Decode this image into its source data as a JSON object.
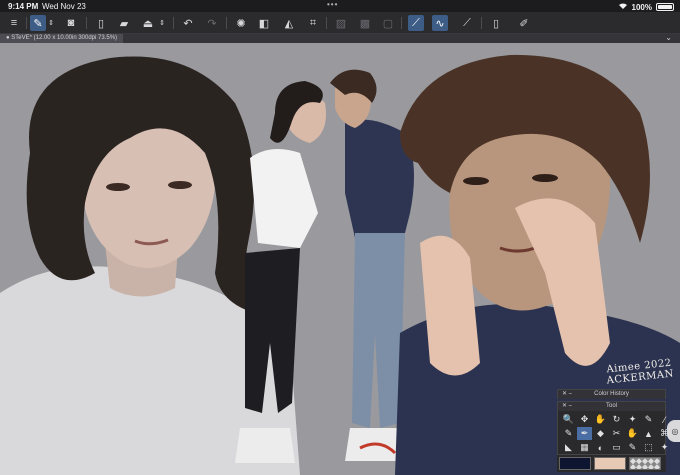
{
  "status": {
    "time": "9:14 PM",
    "date": "Wed Nov 23",
    "dots": "•••",
    "battery": "100%",
    "battery_level": 1.0
  },
  "toolbar": {
    "icons": [
      "menu-icon",
      "pen-icon",
      "chevron-icon",
      "camera-icon",
      "new-file-icon",
      "folder-icon",
      "save-icon",
      "chevron-icon",
      "undo-icon",
      "redo-icon",
      "loading-icon",
      "fill-icon",
      "transform-icon",
      "layer-icon",
      "clear-icon",
      "crop-icon",
      "ruler-icon",
      "stabilizer-icon",
      "pressure-icon",
      "phone-icon",
      "settings-icon"
    ]
  },
  "canvas_tab": {
    "label": "● STeVE* (12.00 x 10.00in 300dpi 73.5%)",
    "collapse": "⌄"
  },
  "artwork": {
    "signature_line1": "Aimee 2022",
    "signature_line2": "ACKERMAN"
  },
  "palettes": {
    "color_history": {
      "title": "Color History",
      "close": "✕ ⎯"
    },
    "tool": {
      "title": "Tool",
      "close": "✕ ⎯",
      "row1": [
        "🔍",
        "✥",
        "✋",
        "↻",
        "✦",
        "✎",
        "⁄"
      ],
      "row2": [
        "✎",
        "✒",
        "◆",
        "✂",
        "✋",
        "▲",
        "⌘"
      ],
      "row3": [
        "◣",
        "▦",
        "◐",
        "▭",
        "✎",
        "⬚",
        "✦"
      ]
    },
    "swatches": {
      "main": "#0d1530",
      "sub": "#e8c9b4"
    }
  },
  "colors": {
    "canvas_bg": "#9a9a9e",
    "accent": "#3d5d86"
  }
}
